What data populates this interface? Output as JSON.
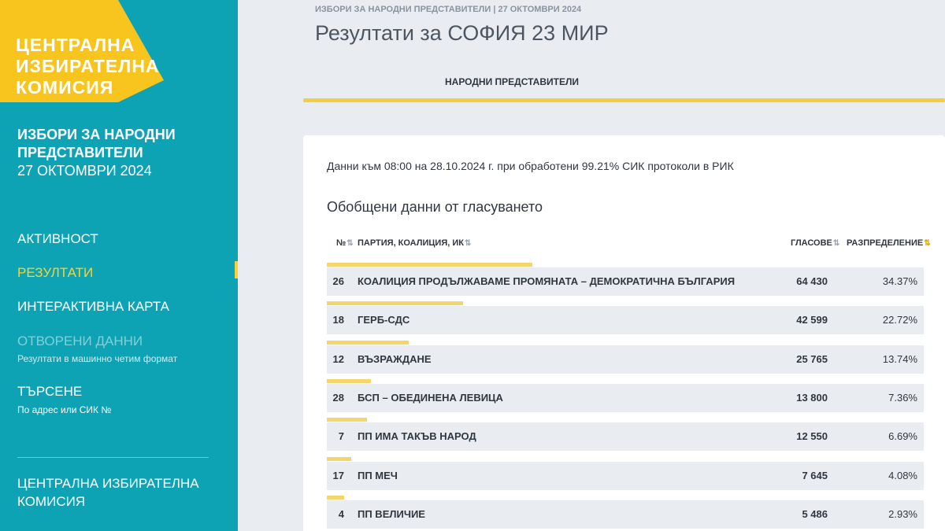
{
  "sidebar": {
    "logo": {
      "line1": "ЦЕНТРАЛНА",
      "line2": "ИЗБИРАТЕЛНА",
      "line3": "КОМИСИЯ"
    },
    "election": {
      "line1": "ИЗБОРИ ЗА НАРОДНИ",
      "line2": "ПРЕДСТАВИТЕЛИ",
      "date": "27 ОКТОМВРИ 2024"
    },
    "nav": {
      "activity": "АКТИВНОСТ",
      "results": "РЕЗУЛТАТИ",
      "map": "ИНТЕРАКТИВНА КАРТА",
      "open_data": "ОТВОРЕНИ ДАННИ",
      "open_data_sub": "Резултати в машинно четим формат",
      "search": "ТЪРСЕНЕ",
      "search_sub": "По адрес или СИК №"
    },
    "footer": {
      "line1": "ЦЕНТРАЛНА ИЗБИРАТЕЛНА",
      "line2": "КОМИСИЯ"
    }
  },
  "header": {
    "breadcrumb": "ИЗБОРИ ЗА НАРОДНИ ПРЕДСТАВИТЕЛИ | 27 ОКТОМВРИ 2024",
    "title": "Резултати за СОФИЯ 23 МИР",
    "tab": "НАРОДНИ ПРЕДСТАВИТЕЛИ"
  },
  "main": {
    "note": "Данни към 08:00 на 28.10.2024 г. при обработени 99.21% СИК протоколи в РИК",
    "section_title": "Обобщени данни от гласуването",
    "columns": {
      "num": "№",
      "party": "ПАРТИЯ, КОАЛИЦИЯ, ИК",
      "votes": "ГЛАСОВЕ",
      "distribution": "РАЗПРЕДЕЛЕНИЕ"
    },
    "rows": [
      {
        "num": "26",
        "party": "КОАЛИЦИЯ ПРОДЪЛЖАВАМЕ ПРОМЯНАТА – ДЕМОКРАТИЧНА БЪЛГАРИЯ",
        "votes": "64 430",
        "pct": "34.37%",
        "share": 34.37
      },
      {
        "num": "18",
        "party": "ГЕРБ-СДС",
        "votes": "42 599",
        "pct": "22.72%",
        "share": 22.72
      },
      {
        "num": "12",
        "party": "ВЪЗРАЖДАНЕ",
        "votes": "25 765",
        "pct": "13.74%",
        "share": 13.74
      },
      {
        "num": "28",
        "party": "БСП – ОБЕДИНЕНА ЛЕВИЦА",
        "votes": "13 800",
        "pct": "7.36%",
        "share": 7.36
      },
      {
        "num": "7",
        "party": "ПП ИМА ТАКЪВ НАРОД",
        "votes": "12 550",
        "pct": "6.69%",
        "share": 6.69
      },
      {
        "num": "17",
        "party": "ПП МЕЧ",
        "votes": "7 645",
        "pct": "4.08%",
        "share": 4.08
      },
      {
        "num": "4",
        "party": "ПП ВЕЛИЧИЕ",
        "votes": "5 486",
        "pct": "2.93%",
        "share": 2.93
      }
    ]
  },
  "colors": {
    "sidebar": "#0ea3b4",
    "accent": "#f5d33b",
    "logo_bg": "#f7c51d"
  }
}
